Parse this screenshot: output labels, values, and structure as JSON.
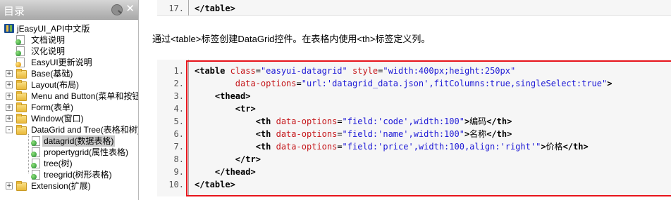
{
  "left_panel": {
    "title": "目录",
    "tree": [
      {
        "label": "jEasyUI_API中文版",
        "icon": "book-icon",
        "level": 0,
        "expander": ""
      },
      {
        "label": "文档说明",
        "icon": "page-icon",
        "level": 1,
        "expander": ""
      },
      {
        "label": "汉化说明",
        "icon": "page-icon",
        "level": 1,
        "expander": ""
      },
      {
        "label": "EasyUI更新说明",
        "icon": "note-icon",
        "level": 1,
        "expander": ""
      },
      {
        "label": "Base(基础)",
        "icon": "folder-icon",
        "level": 1,
        "expander": "+"
      },
      {
        "label": "Layout(布局)",
        "icon": "folder-icon",
        "level": 1,
        "expander": "+"
      },
      {
        "label": "Menu and Button(菜单和按钮)",
        "icon": "folder-icon",
        "level": 1,
        "expander": "+"
      },
      {
        "label": "Form(表单)",
        "icon": "folder-icon",
        "level": 1,
        "expander": "+"
      },
      {
        "label": "Window(窗口)",
        "icon": "folder-icon",
        "level": 1,
        "expander": "+"
      },
      {
        "label": "DataGrid and Tree(表格和树)",
        "icon": "folder-icon",
        "level": 1,
        "expander": "-"
      },
      {
        "label": "datagrid(数据表格)",
        "icon": "page-icon",
        "level": 2,
        "expander": "",
        "selected": true
      },
      {
        "label": "propertygrid(属性表格)",
        "icon": "page-icon",
        "level": 2,
        "expander": ""
      },
      {
        "label": "tree(树)",
        "icon": "page-icon",
        "level": 2,
        "expander": ""
      },
      {
        "label": "treegrid(树形表格)",
        "icon": "page-icon",
        "level": 2,
        "expander": ""
      },
      {
        "label": "Extension(扩展)",
        "icon": "folder-icon",
        "level": 1,
        "expander": "+"
      }
    ]
  },
  "content": {
    "top_code": {
      "line": "17.",
      "text": "</table>"
    },
    "paragraph": "通过<table>标签创建DataGrid控件。在表格内使用<th>标签定义列。",
    "code_lines": [
      {
        "n": "1.",
        "parts": [
          [
            "tag",
            "<table "
          ],
          [
            "attr",
            "class"
          ],
          [
            "txt",
            "="
          ],
          [
            "str",
            "\"easyui-datagrid\""
          ],
          [
            "txt",
            " "
          ],
          [
            "attr",
            "style"
          ],
          [
            "txt",
            "="
          ],
          [
            "str",
            "\"width:400px;height:250px\""
          ]
        ]
      },
      {
        "n": "2.",
        "parts": [
          [
            "txt",
            "        "
          ],
          [
            "attr",
            "data-options"
          ],
          [
            "txt",
            "="
          ],
          [
            "str",
            "\"url:'datagrid_data.json',fitColumns:true,singleSelect:true\""
          ],
          [
            "tag",
            ">"
          ]
        ]
      },
      {
        "n": "3.",
        "parts": [
          [
            "txt",
            "    "
          ],
          [
            "tag",
            "<thead>"
          ]
        ]
      },
      {
        "n": "4.",
        "parts": [
          [
            "txt",
            "        "
          ],
          [
            "tag",
            "<tr>"
          ]
        ]
      },
      {
        "n": "5.",
        "parts": [
          [
            "txt",
            "            "
          ],
          [
            "tag",
            "<th "
          ],
          [
            "attr",
            "data-options"
          ],
          [
            "txt",
            "="
          ],
          [
            "str",
            "\"field:'code',width:100\""
          ],
          [
            "tag",
            ">"
          ],
          [
            "txt",
            "编码"
          ],
          [
            "tag",
            "</th>"
          ]
        ]
      },
      {
        "n": "6.",
        "parts": [
          [
            "txt",
            "            "
          ],
          [
            "tag",
            "<th "
          ],
          [
            "attr",
            "data-options"
          ],
          [
            "txt",
            "="
          ],
          [
            "str",
            "\"field:'name',width:100\""
          ],
          [
            "tag",
            ">"
          ],
          [
            "txt",
            "名称"
          ],
          [
            "tag",
            "</th>"
          ]
        ]
      },
      {
        "n": "7.",
        "parts": [
          [
            "txt",
            "            "
          ],
          [
            "tag",
            "<th "
          ],
          [
            "attr",
            "data-options"
          ],
          [
            "txt",
            "="
          ],
          [
            "str",
            "\"field:'price',width:100,align:'right'\""
          ],
          [
            "tag",
            ">"
          ],
          [
            "txt",
            "价格"
          ],
          [
            "tag",
            "</th>"
          ]
        ]
      },
      {
        "n": "8.",
        "parts": [
          [
            "txt",
            "        "
          ],
          [
            "tag",
            "</tr>"
          ]
        ]
      },
      {
        "n": "9.",
        "parts": [
          [
            "txt",
            "    "
          ],
          [
            "tag",
            "</thead>"
          ]
        ]
      },
      {
        "n": "10.",
        "parts": [
          [
            "tag",
            "</table>"
          ]
        ]
      }
    ]
  }
}
